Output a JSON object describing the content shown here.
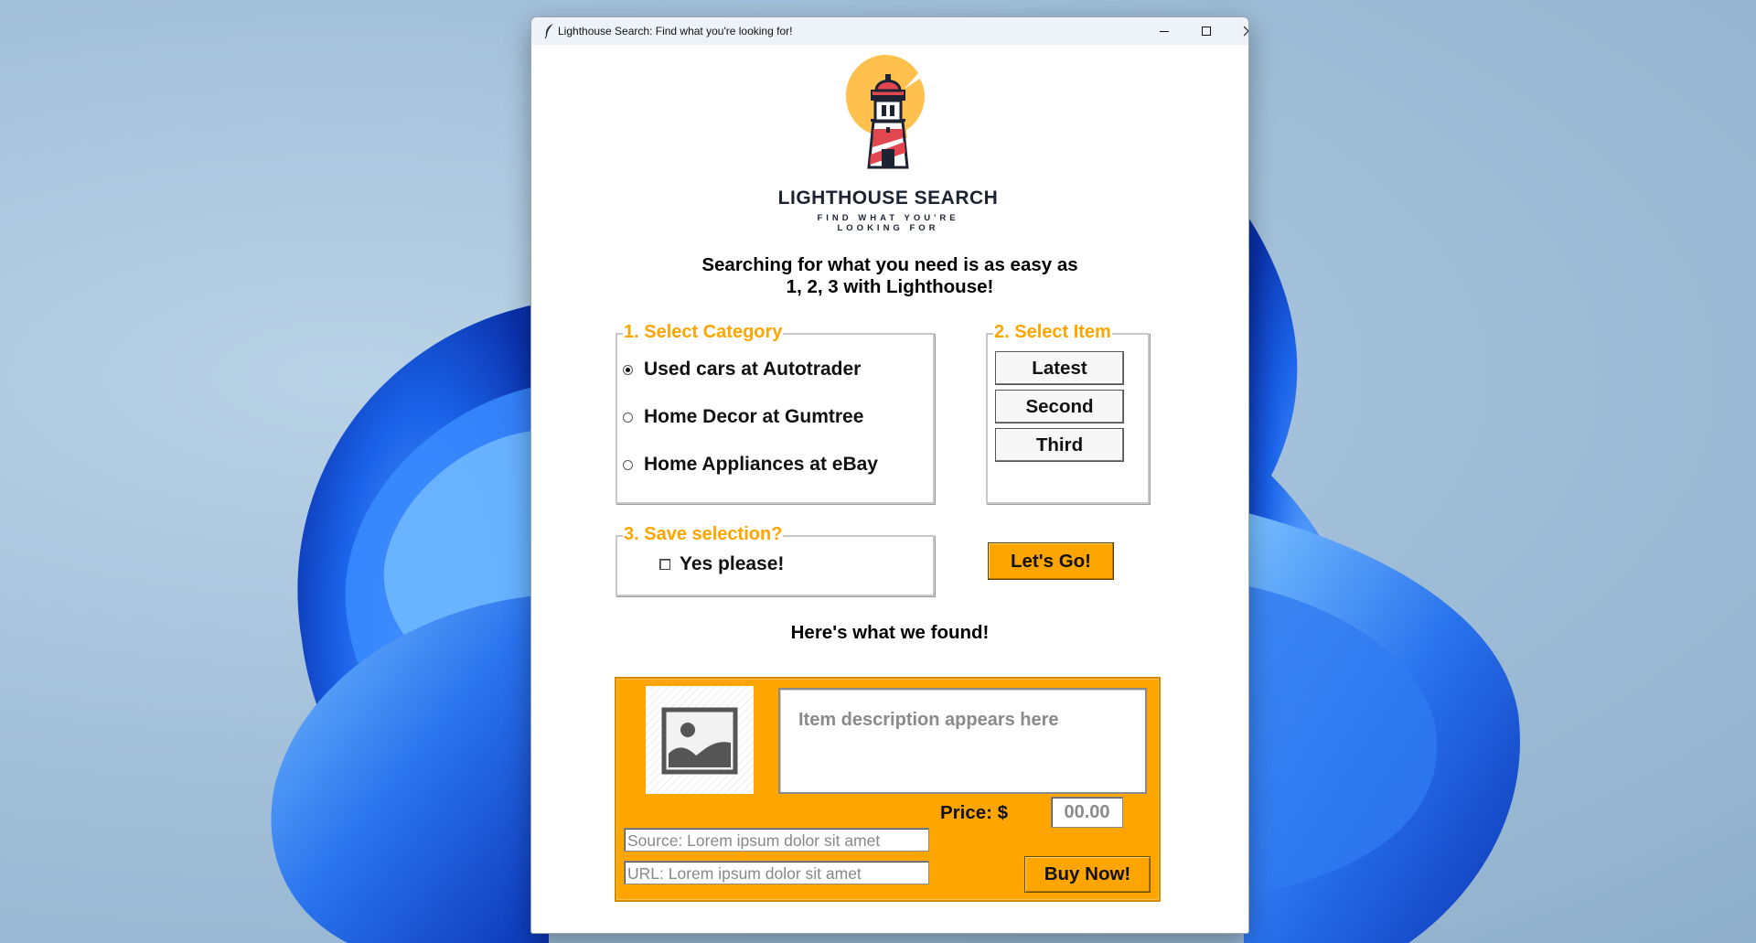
{
  "window": {
    "title": "Lighthouse Search: Find what you're looking for!",
    "controls": [
      "minimize-icon",
      "maximize-icon",
      "close-icon"
    ]
  },
  "logo": {
    "name": "LIGHTHOUSE SEARCH",
    "tagline_line1": "FIND WHAT YOU'RE",
    "tagline_line2": "LOOKING FOR"
  },
  "intro": {
    "line1": "Searching for what you need is as easy as",
    "line2": "1, 2, 3 with Lighthouse!"
  },
  "category": {
    "legend": "1. Select Category",
    "options": [
      {
        "label": "Used cars at Autotrader",
        "selected": true
      },
      {
        "label": "Home Decor at Gumtree",
        "selected": false
      },
      {
        "label": "Home Appliances at eBay",
        "selected": false
      }
    ]
  },
  "item": {
    "legend": "2. Select Item",
    "buttons": [
      "Latest",
      "Second",
      "Third"
    ]
  },
  "save": {
    "legend": "3. Save selection?",
    "checkbox_label": "Yes please!",
    "checked": false
  },
  "go_button": "Let's Go!",
  "results": {
    "heading": "Here's what we found!",
    "image_icon": "image-placeholder-icon",
    "description_placeholder": "Item description appears here",
    "price_label": "Price: $",
    "price_value": "00.00",
    "source": "Source: Lorem ipsum dolor sit amet",
    "url": "URL: Lorem ipsum dolor sit amet",
    "buy_button": "Buy Now!"
  },
  "colors": {
    "accent": "#ffa500",
    "logo_sun": "#ffc04d",
    "logo_red": "#e2464f",
    "logo_dark": "#1d2333"
  }
}
